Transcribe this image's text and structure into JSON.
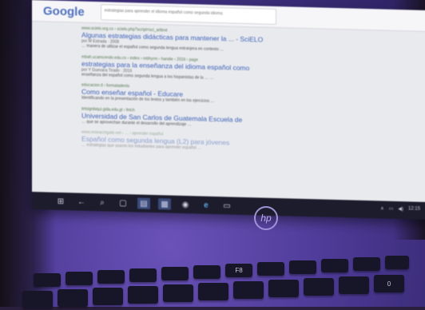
{
  "browser": {
    "logo": "Google",
    "query": "estrategias para aprender el idioma español como segunda idioma"
  },
  "results": [
    {
      "meta": "www.scielo.org.co › scielo.php?script=sci_arttext",
      "title": "Algunas estrategias didácticas para mantener la ... - SciELO",
      "author": "por M Estrada · 2008",
      "snippet": "… manera de utilizar el español como segunda lengua extranjera en contexto …"
    },
    {
      "meta": "mbah.ucamcendo.edu.co › index › rebhyrm › handie › 2016 › page",
      "title": "estrategias para la enseñanza del idioma español como",
      "author": "por Y Guevara Tirado · 2016",
      "snippet": "enseñanza del español como segunda lengua a los hispanistas de la … …"
    },
    {
      "meta": "educacion.tl › formatadenls",
      "title": "Como enseñar español - Educare",
      "author": "",
      "snippet": "Identificando en la presentación de los textos y también en los ejercicios …"
    },
    {
      "meta": "tetsignbiqui.gida.edu.gt › fetch",
      "title": "Universidad de San Carlos de Guatemala Escuela de",
      "author": "",
      "snippet": "… que se aprovechan durante el desarrollo del aprendizaje …"
    },
    {
      "meta": "www.researchgate.net › … › aprender español",
      "title": "Español como segunda lengua (L2) para jóvenes",
      "author": "",
      "snippet": "… estrategias que usaron los estudiantes para aprender español …"
    }
  ],
  "taskbar": {
    "search_glyph": "⌕",
    "back_glyph": "←",
    "start_glyph": "⊞",
    "tray": [
      "∧",
      "▭",
      "◀)",
      "12:15"
    ]
  },
  "hardware": {
    "brand": "hp"
  },
  "keyboard": {
    "keys": [
      "",
      "",
      "",
      "",
      "",
      "",
      "F8",
      "",
      "",
      "",
      "",
      "",
      ""
    ],
    "bottom_keys": [
      "",
      "",
      "",
      "",
      "",
      "",
      "",
      "",
      "",
      "0"
    ]
  }
}
